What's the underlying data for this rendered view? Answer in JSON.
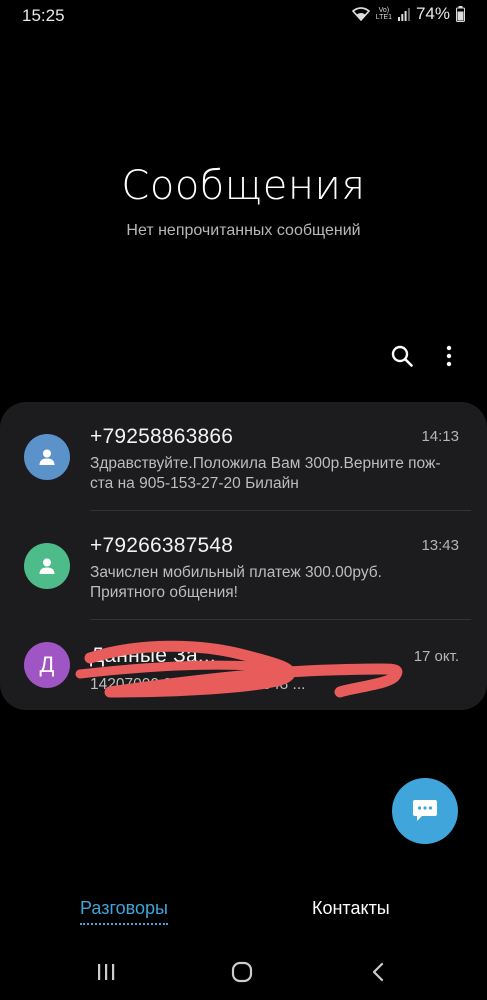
{
  "status_bar": {
    "time": "15:25",
    "network_label_top": "Vo)",
    "network_label_bottom": "LTE1",
    "battery": "74%"
  },
  "header": {
    "title": "Сообщения",
    "subtitle": "Нет непрочитанных сообщений"
  },
  "toolbar": {
    "search_icon": "search-icon",
    "more_icon": "more-vert-icon"
  },
  "conversations": [
    {
      "sender": "+79258863866",
      "time": "14:13",
      "preview": "Здравствуйте.Положила Вам 300р.Верните пож-ста на 905-153-27-20 Билайн",
      "avatar_color": "#5b92c9",
      "avatar_icon": "person-icon"
    },
    {
      "sender": "+79266387548",
      "time": "13:43",
      "preview": "Зачислен мобильный платеж 300.00руб. Приятного общения!",
      "avatar_color": "#4dbb8a",
      "avatar_icon": "person-icon"
    },
    {
      "sender": "Данные За...",
      "time": "17 окт.",
      "preview": "14207000 08... 808003 1548 ...",
      "avatar_letter": "Д",
      "avatar_color": "#a055c4",
      "redacted": true
    }
  ],
  "fab": {
    "icon": "compose-message-icon",
    "color": "#3fa5da"
  },
  "tabs": {
    "conversations": "Разговоры",
    "contacts": "Контакты",
    "accent_color": "#3fa5da"
  },
  "nav_bar": {
    "recents_icon": "recents-icon",
    "home_icon": "home-icon",
    "back_icon": "back-icon"
  }
}
